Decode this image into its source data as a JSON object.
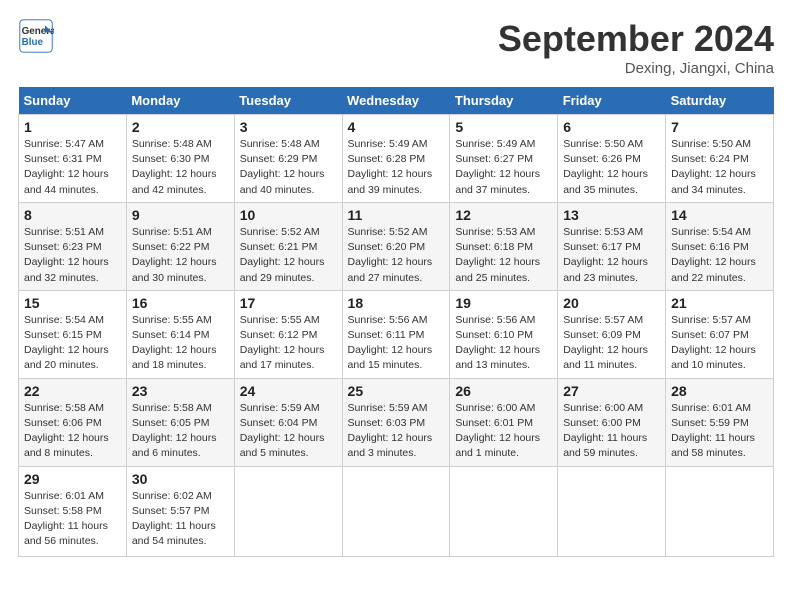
{
  "header": {
    "logo_line1": "General",
    "logo_line2": "Blue",
    "month_title": "September 2024",
    "location": "Dexing, Jiangxi, China"
  },
  "days_of_week": [
    "Sunday",
    "Monday",
    "Tuesday",
    "Wednesday",
    "Thursday",
    "Friday",
    "Saturday"
  ],
  "weeks": [
    [
      {
        "day": "1",
        "sunrise": "5:47 AM",
        "sunset": "6:31 PM",
        "daylight": "12 hours and 44 minutes."
      },
      {
        "day": "2",
        "sunrise": "5:48 AM",
        "sunset": "6:30 PM",
        "daylight": "12 hours and 42 minutes."
      },
      {
        "day": "3",
        "sunrise": "5:48 AM",
        "sunset": "6:29 PM",
        "daylight": "12 hours and 40 minutes."
      },
      {
        "day": "4",
        "sunrise": "5:49 AM",
        "sunset": "6:28 PM",
        "daylight": "12 hours and 39 minutes."
      },
      {
        "day": "5",
        "sunrise": "5:49 AM",
        "sunset": "6:27 PM",
        "daylight": "12 hours and 37 minutes."
      },
      {
        "day": "6",
        "sunrise": "5:50 AM",
        "sunset": "6:26 PM",
        "daylight": "12 hours and 35 minutes."
      },
      {
        "day": "7",
        "sunrise": "5:50 AM",
        "sunset": "6:24 PM",
        "daylight": "12 hours and 34 minutes."
      }
    ],
    [
      {
        "day": "8",
        "sunrise": "5:51 AM",
        "sunset": "6:23 PM",
        "daylight": "12 hours and 32 minutes."
      },
      {
        "day": "9",
        "sunrise": "5:51 AM",
        "sunset": "6:22 PM",
        "daylight": "12 hours and 30 minutes."
      },
      {
        "day": "10",
        "sunrise": "5:52 AM",
        "sunset": "6:21 PM",
        "daylight": "12 hours and 29 minutes."
      },
      {
        "day": "11",
        "sunrise": "5:52 AM",
        "sunset": "6:20 PM",
        "daylight": "12 hours and 27 minutes."
      },
      {
        "day": "12",
        "sunrise": "5:53 AM",
        "sunset": "6:18 PM",
        "daylight": "12 hours and 25 minutes."
      },
      {
        "day": "13",
        "sunrise": "5:53 AM",
        "sunset": "6:17 PM",
        "daylight": "12 hours and 23 minutes."
      },
      {
        "day": "14",
        "sunrise": "5:54 AM",
        "sunset": "6:16 PM",
        "daylight": "12 hours and 22 minutes."
      }
    ],
    [
      {
        "day": "15",
        "sunrise": "5:54 AM",
        "sunset": "6:15 PM",
        "daylight": "12 hours and 20 minutes."
      },
      {
        "day": "16",
        "sunrise": "5:55 AM",
        "sunset": "6:14 PM",
        "daylight": "12 hours and 18 minutes."
      },
      {
        "day": "17",
        "sunrise": "5:55 AM",
        "sunset": "6:12 PM",
        "daylight": "12 hours and 17 minutes."
      },
      {
        "day": "18",
        "sunrise": "5:56 AM",
        "sunset": "6:11 PM",
        "daylight": "12 hours and 15 minutes."
      },
      {
        "day": "19",
        "sunrise": "5:56 AM",
        "sunset": "6:10 PM",
        "daylight": "12 hours and 13 minutes."
      },
      {
        "day": "20",
        "sunrise": "5:57 AM",
        "sunset": "6:09 PM",
        "daylight": "12 hours and 11 minutes."
      },
      {
        "day": "21",
        "sunrise": "5:57 AM",
        "sunset": "6:07 PM",
        "daylight": "12 hours and 10 minutes."
      }
    ],
    [
      {
        "day": "22",
        "sunrise": "5:58 AM",
        "sunset": "6:06 PM",
        "daylight": "12 hours and 8 minutes."
      },
      {
        "day": "23",
        "sunrise": "5:58 AM",
        "sunset": "6:05 PM",
        "daylight": "12 hours and 6 minutes."
      },
      {
        "day": "24",
        "sunrise": "5:59 AM",
        "sunset": "6:04 PM",
        "daylight": "12 hours and 5 minutes."
      },
      {
        "day": "25",
        "sunrise": "5:59 AM",
        "sunset": "6:03 PM",
        "daylight": "12 hours and 3 minutes."
      },
      {
        "day": "26",
        "sunrise": "6:00 AM",
        "sunset": "6:01 PM",
        "daylight": "12 hours and 1 minute."
      },
      {
        "day": "27",
        "sunrise": "6:00 AM",
        "sunset": "6:00 PM",
        "daylight": "11 hours and 59 minutes."
      },
      {
        "day": "28",
        "sunrise": "6:01 AM",
        "sunset": "5:59 PM",
        "daylight": "11 hours and 58 minutes."
      }
    ],
    [
      {
        "day": "29",
        "sunrise": "6:01 AM",
        "sunset": "5:58 PM",
        "daylight": "11 hours and 56 minutes."
      },
      {
        "day": "30",
        "sunrise": "6:02 AM",
        "sunset": "5:57 PM",
        "daylight": "11 hours and 54 minutes."
      },
      null,
      null,
      null,
      null,
      null
    ]
  ]
}
